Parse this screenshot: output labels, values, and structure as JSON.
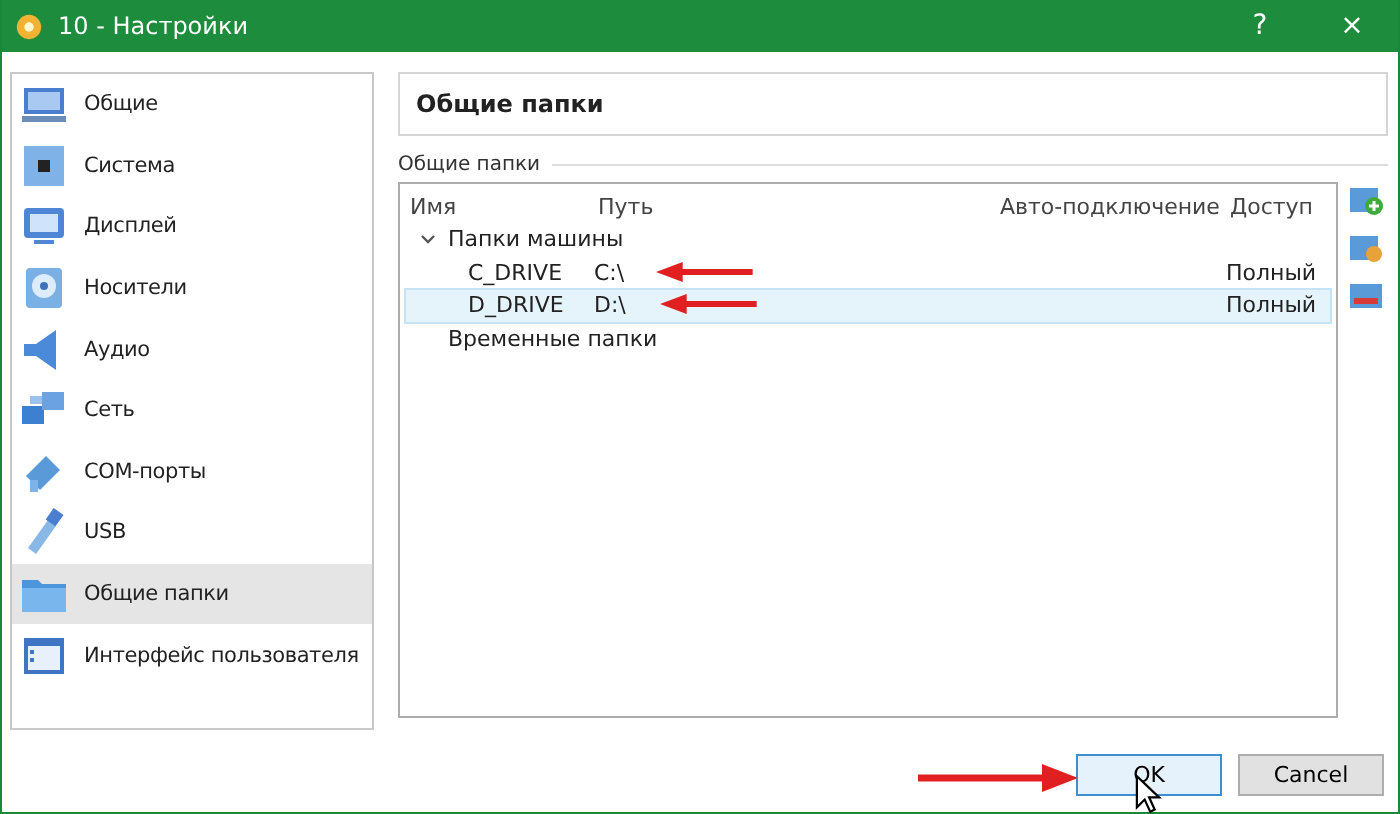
{
  "window": {
    "title": "10 - Настройки",
    "help": "?",
    "close": "×"
  },
  "sidebar": {
    "items": [
      {
        "label": "Общие",
        "selected": false
      },
      {
        "label": "Система",
        "selected": false
      },
      {
        "label": "Дисплей",
        "selected": false
      },
      {
        "label": "Носители",
        "selected": false
      },
      {
        "label": "Аудио",
        "selected": false
      },
      {
        "label": "Сеть",
        "selected": false
      },
      {
        "label": "COM-порты",
        "selected": false
      },
      {
        "label": "USB",
        "selected": false
      },
      {
        "label": "Общие папки",
        "selected": true
      },
      {
        "label": "Интерфейс пользователя",
        "selected": false
      }
    ]
  },
  "page_title": "Общие папки",
  "group_label": "Общие папки",
  "table": {
    "columns": [
      "Имя",
      "Путь",
      "Авто-подключение",
      "Доступ"
    ],
    "groups": [
      {
        "label": "Папки машины",
        "expanded": true,
        "children": [
          {
            "name": "C_DRIVE",
            "path": "C:\\",
            "access": "Полный",
            "selected": false
          },
          {
            "name": "D_DRIVE",
            "path": "D:\\",
            "access": "Полный",
            "selected": true
          }
        ]
      },
      {
        "label": "Временные папки"
      }
    ]
  },
  "buttons": [
    "OK",
    "Cancel"
  ]
}
